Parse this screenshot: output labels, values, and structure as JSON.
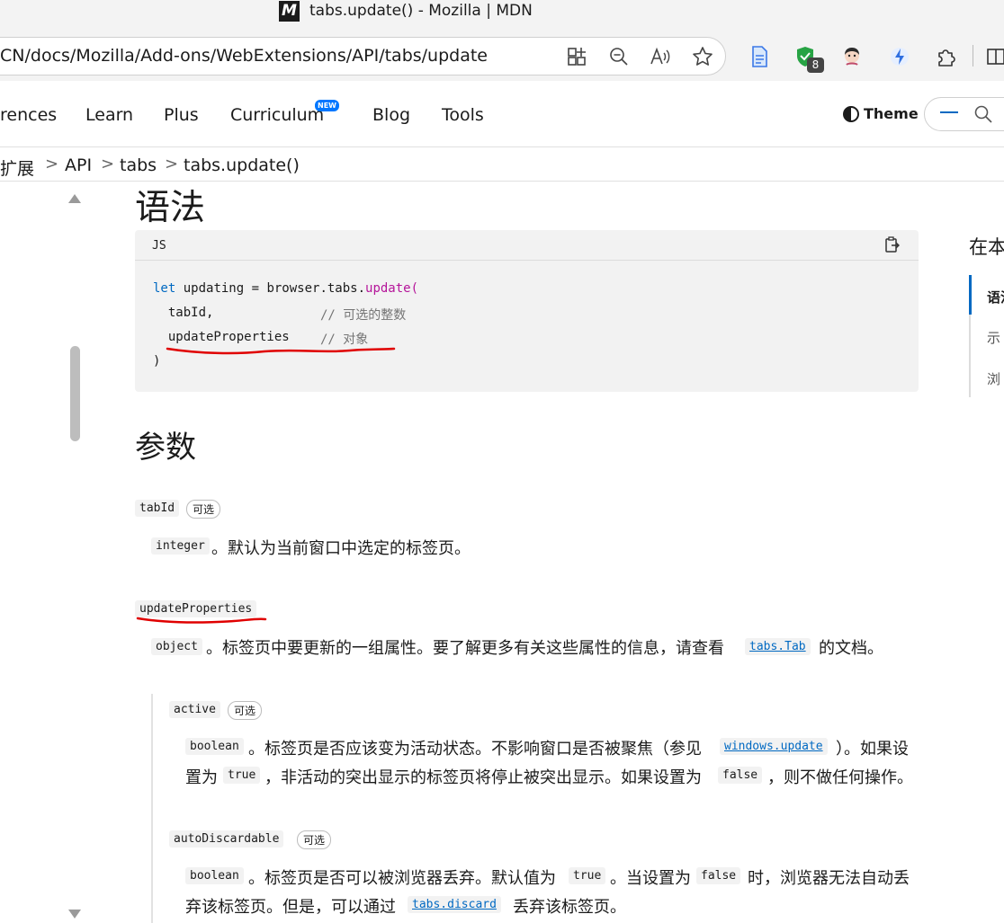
{
  "window": {
    "title": "tabs.update() - Mozilla | MDN",
    "favicon": "M"
  },
  "addressbar": {
    "url": "CN/docs/Mozilla/Add-ons/WebExtensions/API/tabs/update",
    "extension_badge": "8"
  },
  "nav": {
    "items": [
      "rences",
      "Learn",
      "Plus",
      "Curriculum",
      "Blog",
      "Tools"
    ],
    "new_badge": "NEW",
    "theme": "Theme"
  },
  "breadcrumb": {
    "items": [
      "扩展",
      "API",
      "tabs",
      "tabs.update()"
    ],
    "separator": ">"
  },
  "syntax": {
    "heading": "语法",
    "code_lang": "JS",
    "code": {
      "line1_kw": "let",
      "line1_var": " updating = browser.tabs.",
      "line1_fn": "update",
      "line1_paren": "(",
      "line2_arg": "  tabId,",
      "line2_comment": "// 可选的整数",
      "line3_arg": "  updateProperties",
      "line3_comment": "// 对象",
      "line4": ")"
    }
  },
  "params": {
    "heading": "参数",
    "optional": "可选",
    "tabId": {
      "name": "tabId",
      "type": "integer",
      "desc": "。默认为当前窗口中选定的标签页。"
    },
    "updateProperties": {
      "name": "updateProperties",
      "type": "object",
      "desc_pre": "。标签页中要更新的一组属性。要了解更多有关这些属性的信息，请查看",
      "link": "tabs.Tab",
      "desc_post": "的文档。"
    },
    "active": {
      "name": "active",
      "type": "boolean",
      "desc1_pre": "。标签页是否应该变为活动状态。不影响窗口是否被聚焦（参见",
      "link": "windows.update",
      "desc1_post": "）。如果设",
      "desc2_pre": "置为",
      "val_true": "true",
      "desc2_mid": "，非活动的突出显示的标签页将停止被突出显示。如果设置为",
      "val_false": "false",
      "desc2_post": "，则不做任何操作。"
    },
    "autoDiscardable": {
      "name": "autoDiscardable",
      "type": "boolean",
      "desc1_pre": "。标签页是否可以被浏览器丢弃。默认值为",
      "val_true": "true",
      "desc1_mid": "。当设置为",
      "val_false": "false",
      "desc1_post": "时，浏览器无法自动丢",
      "desc2_pre": "弃该标签页。但是，可以通过",
      "link": "tabs.discard",
      "desc2_post": "丢弃该标签页。"
    }
  },
  "toc": {
    "title": "在本",
    "items": [
      "语法",
      "示",
      "浏"
    ]
  },
  "colors": {
    "link": "#0069c2",
    "annotation": "#e00000",
    "code_bg": "#f2f2f2"
  }
}
